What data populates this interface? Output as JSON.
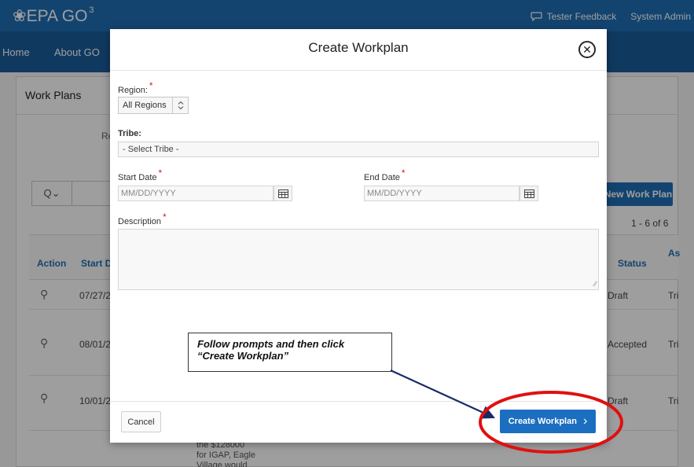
{
  "app": {
    "logo_text": "❀EPA GO",
    "logo_superscript": "3",
    "feedback_label": "Tester Feedback",
    "user_label": "System Admin"
  },
  "nav": {
    "items": [
      {
        "label": "Home"
      },
      {
        "label": "About GO"
      }
    ]
  },
  "background_page": {
    "region_title": "Work Plans",
    "search_icon_text": "Q⌄",
    "new_button_label": "New Work Plan",
    "pagination": "1 - 6 of 6",
    "filter_label_partial": "Re",
    "columns": {
      "action": "Action",
      "start_date": "Start Da",
      "status": "Status",
      "assigned": "As"
    },
    "rows": [
      {
        "start_date": "07/27/2(",
        "status": "Draft",
        "assigned": "Tri"
      },
      {
        "start_date": "08/01/2(",
        "status": "Accepted",
        "assigned": "Tri"
      },
      {
        "start_date": "10/01/2(",
        "status": "Draft",
        "assigned": "Tri"
      }
    ],
    "snippet_lines": [
      "the $128000",
      "for IGAP, Eagle",
      "Village would"
    ]
  },
  "dialog": {
    "title": "Create Workplan",
    "close_icon": "close-icon",
    "region": {
      "label": "Region:",
      "required": "*",
      "value": "All Regions"
    },
    "tribe": {
      "label": "Tribe:",
      "value": "- Select Tribe -"
    },
    "start_date": {
      "label": "Start Date",
      "required": "*",
      "placeholder": "MM/DD/YYYY"
    },
    "end_date": {
      "label": "End Date",
      "required": "*",
      "placeholder": "MM/DD/YYYY"
    },
    "description": {
      "label": "Description",
      "required": "*"
    },
    "cancel_label": "Cancel",
    "create_label": "Create Workplan",
    "create_chevron": "›"
  },
  "annotation": {
    "line1": "Follow prompts and then click",
    "line2": "“Create Workplan”"
  },
  "colors": {
    "brand_blue": "#1f6fb5",
    "nav_blue": "#1a5d9c",
    "primary_button": "#1c6ec0",
    "required_star": "#d21f1f",
    "annotation_circle": "#e01010",
    "annotation_arrow": "#1a2a66"
  }
}
